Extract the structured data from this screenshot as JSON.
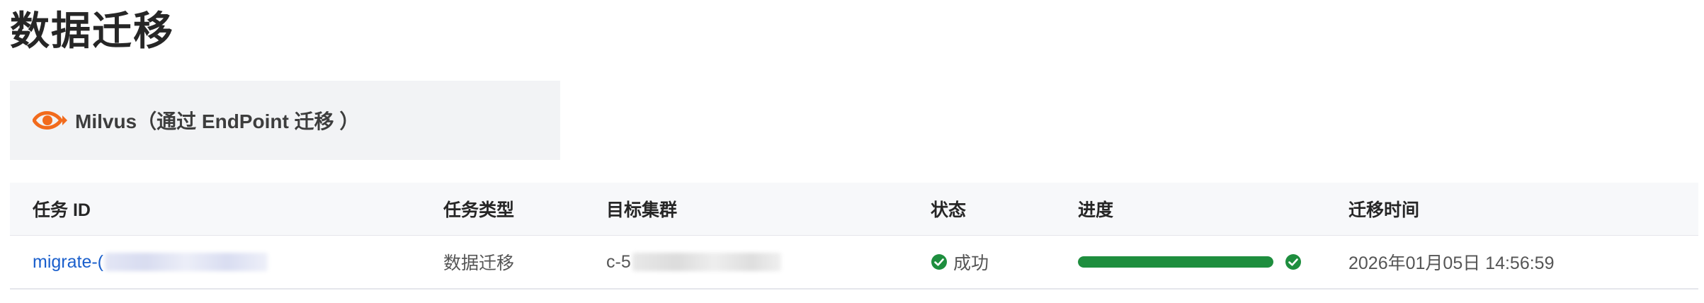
{
  "page": {
    "title": "数据迁移"
  },
  "source": {
    "label": "Milvus（通过 EndPoint 迁移 ）",
    "logo_icon": "milvus-eye-logo",
    "accent_color": "#f26b1d"
  },
  "table": {
    "columns": [
      "任务 ID",
      "任务类型",
      "目标集群",
      "状态",
      "进度",
      "迁移时间"
    ],
    "rows": [
      {
        "task_id": "migrate-(",
        "task_type": "数据迁移",
        "target_cluster": "c-5",
        "status": "成功",
        "status_icon": "check-circle-icon",
        "status_color": "#1e8e3e",
        "progress": 1.0,
        "progress_icon": "check-circle-icon",
        "migration_time": "2026年01月05日 14:56:59"
      }
    ]
  },
  "colors": {
    "link": "#1a5fcc",
    "success": "#1e8e3e",
    "card_bg": "#f2f3f5",
    "header_bg": "#f7f8fa"
  }
}
